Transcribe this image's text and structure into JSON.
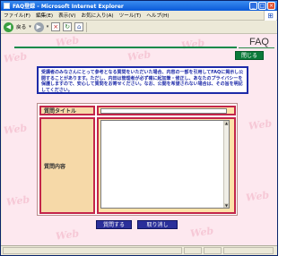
{
  "window": {
    "title": "FAQ登録 - Microsoft Internet Explorer"
  },
  "menu": [
    "ファイル(F)",
    "編集(E)",
    "表示(V)",
    "お気に入り(A)",
    "ツール(T)",
    "ヘルプ(H)"
  ],
  "toolbar": {
    "back_label": "戻る"
  },
  "page": {
    "heading": "FAQ",
    "close_label": "閉じる",
    "watermark": "Web",
    "notice": "受講者のみなさんにとって参考となる質問をいただいた場合、内容の一部を引用してFAQに掲示し公開することがあります。ただし、内田は管理者が必ず確に起加筆・修正し、あなたのプライバシーを保護しますので、安心して質問をお寄せください。なお、公開を希望されない場合は、その旨を明記してください。",
    "form": {
      "title_label": "質問タイトル",
      "title_value": "",
      "body_label": "質問内容",
      "body_value": ""
    },
    "submit_label": "質問する",
    "cancel_label": "取り消し"
  }
}
